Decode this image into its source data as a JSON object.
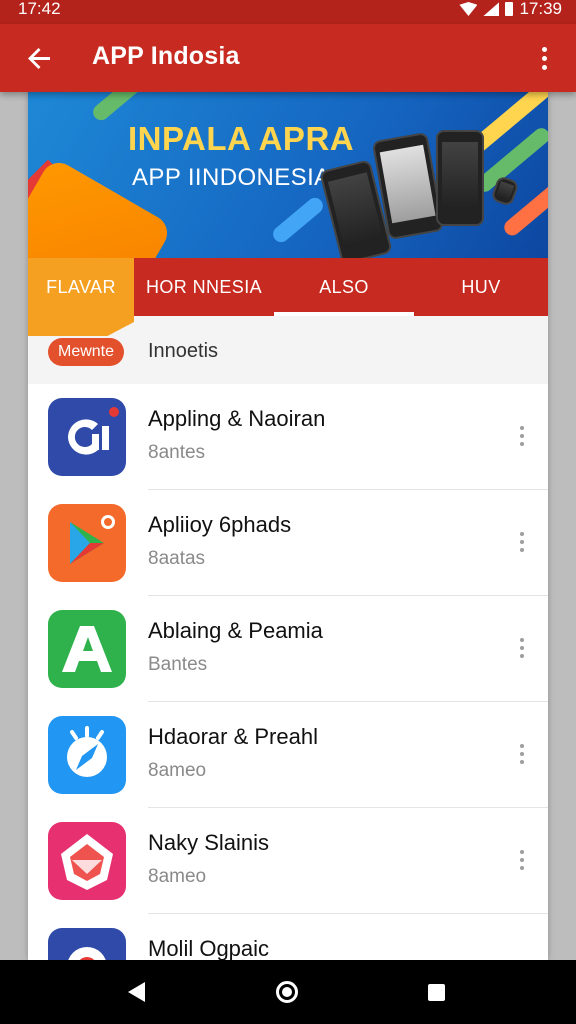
{
  "status_bar": {
    "time_left": "17:42",
    "time_right": "17:39"
  },
  "app_bar": {
    "title": "APP Indosia"
  },
  "banner": {
    "title": "INPALA APRA",
    "subtitle": "APP IINDONESIA"
  },
  "tabs": [
    {
      "label": "FLAVAR"
    },
    {
      "label": "HOR NNESIA"
    },
    {
      "label": "ALSO"
    },
    {
      "label": "HUV"
    }
  ],
  "filter": {
    "chip": "Mewnte",
    "text": "Innoetis"
  },
  "apps": [
    {
      "name": "Appling & Naoiran",
      "sub": "8antes",
      "icon": "dark-blue-logo-icon",
      "color": "#2f4aa8"
    },
    {
      "name": "Apliioy 6phads",
      "sub": "8aatas",
      "icon": "play-store-icon",
      "color": "#f46a2b"
    },
    {
      "name": "Ablaing & Peamia",
      "sub": "Bantes",
      "icon": "letter-a-icon",
      "color": "#2fb24c"
    },
    {
      "name": "Hdaorar & Preahl",
      "sub": "8ameo",
      "icon": "compass-icon",
      "color": "#2196f3"
    },
    {
      "name": "Naky Slainis",
      "sub": "8ameo",
      "icon": "diamond-shape-icon",
      "color": "#e6306f"
    },
    {
      "name": "Molil Ogpaic",
      "sub": "",
      "icon": "circle-logo-icon",
      "color": "#2f4aa8"
    }
  ]
}
